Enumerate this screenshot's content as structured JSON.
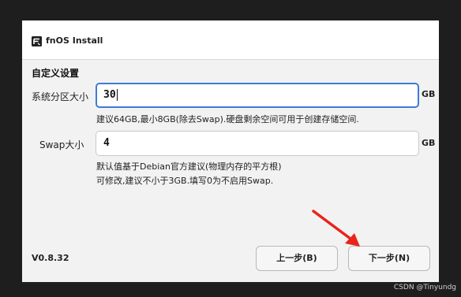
{
  "window": {
    "app_title": "fnOS Install",
    "logo_icon": "fnos-logo-icon"
  },
  "section_title": "自定义设置",
  "system_partition": {
    "label": "系统分区大小",
    "value": "30",
    "unit": "GB",
    "hint": "建议64GB,最小8GB(除去Swap).硬盘剩余空间可用于创建存储空间."
  },
  "swap": {
    "label": "Swap大小",
    "value": "4",
    "unit": "GB",
    "hint_line1": "默认值基于Debian官方建议(物理内存的平方根)",
    "hint_line2": "可修改,建议不小于3GB.填写0为不启用Swap."
  },
  "footer": {
    "version": "V0.8.32",
    "prev_label": "上一步(B)",
    "next_label": "下一步(N)"
  },
  "annotation": {
    "arrow_color": "#e8241b"
  },
  "watermark": "CSDN @Tinyundg"
}
